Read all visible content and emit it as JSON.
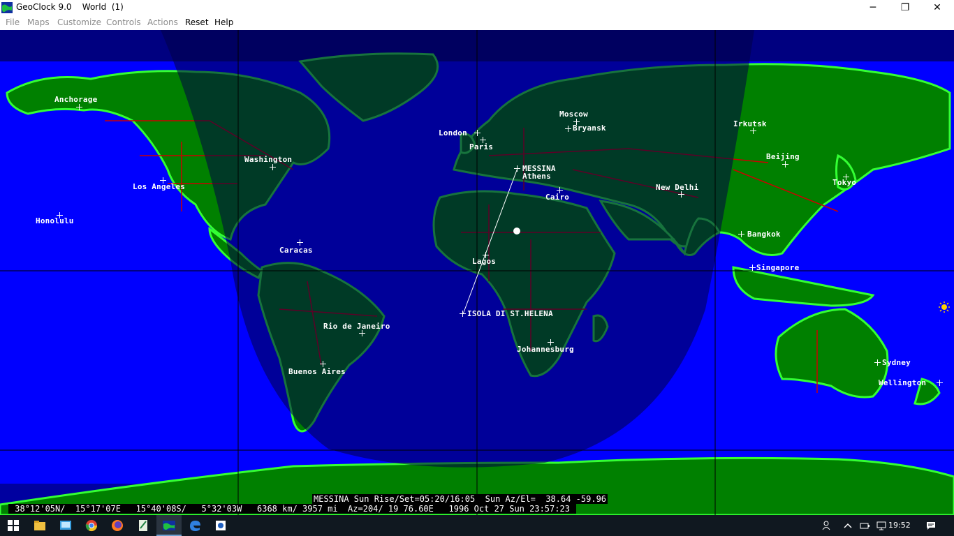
{
  "window": {
    "app_name": "GeoClock 9.0",
    "document": "World  (1)",
    "controls": {
      "minimize": "─",
      "maximize": "❐",
      "close": "✕"
    }
  },
  "menu": [
    {
      "label": "File",
      "enabled": false
    },
    {
      "label": "Maps",
      "enabled": false
    },
    {
      "label": "Customize",
      "enabled": false
    },
    {
      "label": "Controls",
      "enabled": false
    },
    {
      "label": "Actions",
      "enabled": false
    },
    {
      "label": "Reset",
      "enabled": true
    },
    {
      "label": "Help",
      "enabled": true
    }
  ],
  "cities": [
    {
      "id": "anchorage",
      "label": "Anchorage"
    },
    {
      "id": "moscow",
      "label": "Moscow"
    },
    {
      "id": "bryansk",
      "label": "Bryansk"
    },
    {
      "id": "london",
      "label": "London"
    },
    {
      "id": "paris",
      "label": "Paris"
    },
    {
      "id": "irkutsk",
      "label": "Irkutsk"
    },
    {
      "id": "beijing",
      "label": "Beijing"
    },
    {
      "id": "tokyo",
      "label": "Tokyo"
    },
    {
      "id": "washington",
      "label": "Washington"
    },
    {
      "id": "los-angeles",
      "label": "Los Angeles"
    },
    {
      "id": "messina",
      "label": "MESSINA"
    },
    {
      "id": "athens",
      "label": "Athens"
    },
    {
      "id": "new-delhi",
      "label": "New Delhi"
    },
    {
      "id": "cairo",
      "label": "Cairo"
    },
    {
      "id": "honolulu",
      "label": "Honolulu"
    },
    {
      "id": "bangkok",
      "label": "Bangkok"
    },
    {
      "id": "caracas",
      "label": "Caracas"
    },
    {
      "id": "lagos",
      "label": "Lagos"
    },
    {
      "id": "singapore",
      "label": "Singapore"
    },
    {
      "id": "st-helena",
      "label": "ISOLA DI ST.HELENA"
    },
    {
      "id": "rio",
      "label": "Rio de Janeiro"
    },
    {
      "id": "johannesburg",
      "label": "Johannesburg"
    },
    {
      "id": "sydney",
      "label": "Sydney"
    },
    {
      "id": "buenos-aires",
      "label": "Buenos Aires"
    },
    {
      "id": "wellington",
      "label": "Wellington"
    }
  ],
  "status": {
    "line1": "MESSINA Sun Rise/Set=05:20/16:05  Sun Az/El=  38.64 -59.96",
    "line2": " 38°12'05N/  15°17'07E   15°40'08S/   5°32'03W   6368 km/ 3957 mi  Az=204/ 19 76.60E   1996 Oct 27 Sun 23:57:23 "
  },
  "taskbar": {
    "time": "19:52"
  },
  "colors": {
    "ocean": "#0000ff",
    "land": "#008000",
    "land_light": "#33ff33",
    "night": "rgba(0,0,70,0.55)",
    "border": "#cc0000"
  }
}
